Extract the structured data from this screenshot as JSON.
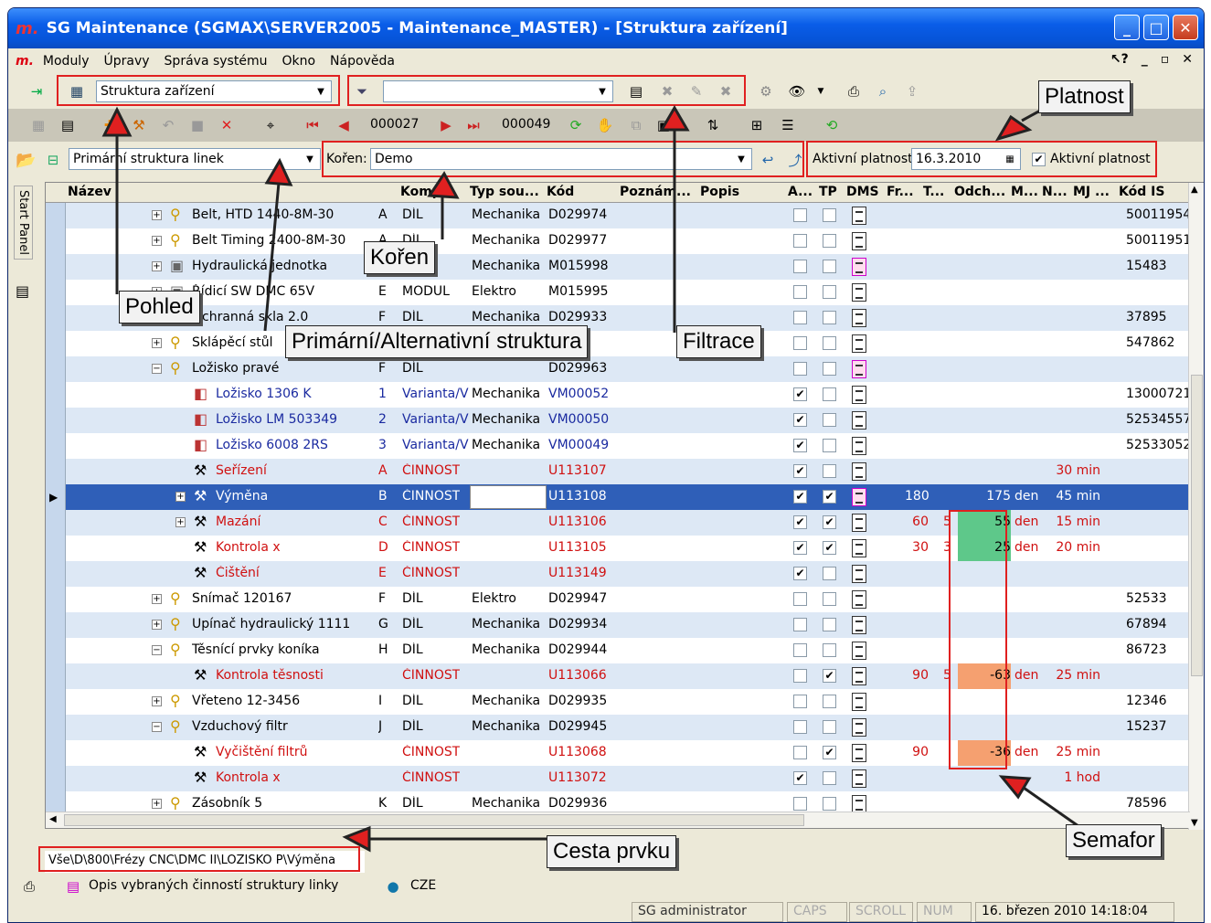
{
  "window": {
    "logo": "m.",
    "title": "SG Maintenance (SGMAX\\SERVER2005 - Maintenance_MASTER) - [Struktura zařízení]"
  },
  "menu": {
    "logo": "m.",
    "items": [
      "Moduly",
      "Úpravy",
      "Správa systému",
      "Okno",
      "Nápověda"
    ],
    "help": "?"
  },
  "toolbar1": {
    "view_combo": "Struktura zařízení",
    "filter_combo": ""
  },
  "toolbar2": {
    "first_record": "000027",
    "last_record": "000049"
  },
  "toolbar3": {
    "structure_combo": "Primární struktura linek",
    "root_label": "Kořen:",
    "root_value": "Demo",
    "validity_label": "Aktivní platnost:",
    "validity_date": "16.3.2010",
    "validity_check": "Aktivní platnost"
  },
  "side": {
    "start_panel": "Start Panel"
  },
  "columns": [
    "Název",
    "",
    "Komp",
    "Typ sou...",
    "Kód",
    "Poznám...",
    "Popis",
    "A...",
    "TP",
    "DMS",
    "Fr...",
    "T...",
    "Odch...",
    "M...",
    "N...",
    "MJ ...",
    "Kód IS"
  ],
  "rows": [
    {
      "name": "Belt, HTD 1440-8M-30",
      "pos": "A",
      "komp": "DÍL",
      "typ": "Mechanika",
      "kod": "D029974",
      "a": false,
      "tp": false,
      "dms": "doc",
      "fr": "",
      "t": "",
      "odch": "",
      "mj": "",
      "n": "",
      "kodis": "50011954",
      "color": "#000",
      "indent": 0,
      "exp": "+",
      "icon": "part"
    },
    {
      "name": "Belt Timing 2400-8M-30",
      "pos": "A",
      "komp": "DÍL",
      "typ": "Mechanika",
      "kod": "D029977",
      "a": false,
      "tp": false,
      "dms": "doc",
      "fr": "",
      "t": "",
      "odch": "",
      "mj": "",
      "n": "",
      "kodis": "50011951",
      "color": "#000",
      "indent": 0,
      "exp": "+",
      "icon": "part"
    },
    {
      "name": "Hydraulická jednotka",
      "pos": "A",
      "komp": "DÍL",
      "typ": "Mechanika",
      "kod": "M015998",
      "a": false,
      "tp": false,
      "dms": "pink",
      "fr": "",
      "t": "",
      "odch": "",
      "mj": "",
      "n": "",
      "kodis": "15483",
      "color": "#000",
      "indent": 0,
      "exp": "+",
      "icon": "box"
    },
    {
      "name": "Řídicí SW DMC 65V",
      "pos": "E",
      "komp": "MODUL",
      "typ": "Elektro",
      "kod": "M015995",
      "a": false,
      "tp": false,
      "dms": "doc",
      "fr": "",
      "t": "",
      "odch": "",
      "mj": "",
      "n": "",
      "kodis": "",
      "color": "#000",
      "indent": 0,
      "exp": "+",
      "icon": "box"
    },
    {
      "name": "Ochranná skla 2.0",
      "pos": "F",
      "komp": "DÍL",
      "typ": "Mechanika",
      "kod": "D029933",
      "a": false,
      "tp": false,
      "dms": "doc",
      "fr": "",
      "t": "",
      "odch": "",
      "mj": "",
      "n": "",
      "kodis": "37895",
      "color": "#000",
      "indent": 0,
      "exp": "+",
      "icon": "part"
    },
    {
      "name": "Sklápěcí stůl",
      "pos": "",
      "komp": "",
      "typ": "",
      "kod": "",
      "a": false,
      "tp": false,
      "dms": "doc",
      "fr": "",
      "t": "",
      "odch": "",
      "mj": "",
      "n": "",
      "kodis": "547862",
      "color": "#000",
      "indent": 0,
      "exp": "+",
      "icon": "part"
    },
    {
      "name": "Ložisko pravé",
      "pos": "F",
      "komp": "DÍL",
      "typ": "",
      "kod": "D029963",
      "a": false,
      "tp": false,
      "dms": "pink",
      "fr": "",
      "t": "",
      "odch": "",
      "mj": "",
      "n": "",
      "kodis": "",
      "color": "#000",
      "indent": 0,
      "exp": "−",
      "icon": "part"
    },
    {
      "name": "Ložisko 1306 K",
      "pos": "1",
      "komp": "Varianta/V",
      "typ": "Mechanika",
      "kod": "VM00052",
      "a": true,
      "tp": false,
      "dms": "doc",
      "fr": "",
      "t": "",
      "odch": "",
      "mj": "",
      "n": "",
      "kodis": "13000721",
      "color": "#1a2aa0",
      "indent": 1,
      "exp": "",
      "icon": "var"
    },
    {
      "name": "Ložisko   LM 503349",
      "pos": "2",
      "komp": "Varianta/V",
      "typ": "Mechanika",
      "kod": "VM00050",
      "a": true,
      "tp": false,
      "dms": "doc",
      "fr": "",
      "t": "",
      "odch": "",
      "mj": "",
      "n": "",
      "kodis": "52534557",
      "color": "#1a2aa0",
      "indent": 1,
      "exp": "",
      "icon": "var"
    },
    {
      "name": "Ložisko 6008 2RS",
      "pos": "3",
      "komp": "Varianta/V",
      "typ": "Mechanika",
      "kod": "VM00049",
      "a": true,
      "tp": false,
      "dms": "doc",
      "fr": "",
      "t": "",
      "odch": "",
      "mj": "",
      "n": "",
      "kodis": "52533052",
      "color": "#1a2aa0",
      "indent": 1,
      "exp": "",
      "icon": "var"
    },
    {
      "name": "Seřízení",
      "pos": "A",
      "komp": "ČINNOST",
      "typ": "",
      "kod": "U113107",
      "a": true,
      "tp": false,
      "dms": "doc",
      "fr": "",
      "t": "",
      "odch": "",
      "mj": "30 min",
      "n": "",
      "kodis": "",
      "color": "#d01010",
      "indent": 1,
      "exp": "",
      "icon": "act"
    },
    {
      "name": "Výměna",
      "pos": "B",
      "komp": "ČINNOST",
      "typ": "",
      "kod": "U113108",
      "a": true,
      "tp": true,
      "dms": "pink",
      "fr": "180",
      "t": "",
      "odch": "175",
      "n": "den",
      "mj": "45 min",
      "kodis": "",
      "color": "#fff",
      "indent": 1,
      "exp": "+",
      "icon": "act",
      "selected": true
    },
    {
      "name": "Mazání",
      "pos": "C",
      "komp": "ČINNOST",
      "typ": "",
      "kod": "U113106",
      "a": true,
      "tp": true,
      "dms": "doc",
      "fr": "60",
      "t": "5",
      "odch": "55",
      "n": "den",
      "mj": "15 min",
      "kodis": "",
      "color": "#d01010",
      "indent": 1,
      "exp": "+",
      "icon": "act",
      "sema": "#5ec88a"
    },
    {
      "name": "Kontrola x",
      "pos": "D",
      "komp": "ČINNOST",
      "typ": "",
      "kod": "U113105",
      "a": true,
      "tp": true,
      "dms": "doc",
      "fr": "30",
      "t": "3",
      "odch": "25",
      "n": "den",
      "mj": "20 min",
      "kodis": "",
      "color": "#d01010",
      "indent": 1,
      "exp": "",
      "icon": "act",
      "sema": "#5ec88a"
    },
    {
      "name": "Čištění",
      "pos": "E",
      "komp": "ČINNOST",
      "typ": "",
      "kod": "U113149",
      "a": true,
      "tp": false,
      "dms": "doc",
      "fr": "",
      "t": "",
      "odch": "",
      "n": "",
      "mj": "",
      "kodis": "",
      "color": "#d01010",
      "indent": 1,
      "exp": "",
      "icon": "act"
    },
    {
      "name": "Snímač  120167",
      "pos": "F",
      "komp": "DÍL",
      "typ": "Elektro",
      "kod": "D029947",
      "a": false,
      "tp": false,
      "dms": "doc",
      "fr": "",
      "t": "",
      "odch": "",
      "n": "",
      "mj": "",
      "kodis": "52533",
      "color": "#000",
      "indent": 0,
      "exp": "+",
      "icon": "part"
    },
    {
      "name": "Upínač hydraulický 1111",
      "pos": "G",
      "komp": "DÍL",
      "typ": "Mechanika",
      "kod": "D029934",
      "a": false,
      "tp": false,
      "dms": "doc",
      "fr": "",
      "t": "",
      "odch": "",
      "n": "",
      "mj": "",
      "kodis": "67894",
      "color": "#000",
      "indent": 0,
      "exp": "+",
      "icon": "part"
    },
    {
      "name": "Těsnící prvky koníka",
      "pos": "H",
      "komp": "DÍL",
      "typ": "Mechanika",
      "kod": "D029944",
      "a": false,
      "tp": false,
      "dms": "doc",
      "fr": "",
      "t": "",
      "odch": "",
      "n": "",
      "mj": "",
      "kodis": "86723",
      "color": "#000",
      "indent": 0,
      "exp": "−",
      "icon": "part"
    },
    {
      "name": "Kontrola těsnosti",
      "pos": "",
      "komp": "ČINNOST",
      "typ": "",
      "kod": "U113066",
      "a": false,
      "tp": true,
      "dms": "doc",
      "fr": "90",
      "t": "5",
      "odch": "-63",
      "n": "den",
      "mj": "25 min",
      "kodis": "",
      "color": "#d01010",
      "indent": 1,
      "exp": "",
      "icon": "act",
      "sema": "#f5a070"
    },
    {
      "name": "Vřeteno 12-3456",
      "pos": "I",
      "komp": "DÍL",
      "typ": "Mechanika",
      "kod": "D029935",
      "a": false,
      "tp": false,
      "dms": "doc",
      "fr": "",
      "t": "",
      "odch": "",
      "n": "",
      "mj": "",
      "kodis": "12346",
      "color": "#000",
      "indent": 0,
      "exp": "+",
      "icon": "part"
    },
    {
      "name": "Vzduchový filtr",
      "pos": "J",
      "komp": "DÍL",
      "typ": "Mechanika",
      "kod": "D029945",
      "a": false,
      "tp": false,
      "dms": "doc",
      "fr": "",
      "t": "",
      "odch": "",
      "n": "",
      "mj": "",
      "kodis": "15237",
      "color": "#000",
      "indent": 0,
      "exp": "−",
      "icon": "part"
    },
    {
      "name": "Vyčištění filtrů",
      "pos": "",
      "komp": "ČINNOST",
      "typ": "",
      "kod": "U113068",
      "a": false,
      "tp": true,
      "dms": "doc",
      "fr": "90",
      "t": "",
      "odch": "-36",
      "n": "den",
      "mj": "25 min",
      "kodis": "",
      "color": "#d01010",
      "indent": 1,
      "exp": "",
      "icon": "act",
      "sema": "#f5a070"
    },
    {
      "name": "Kontrola x",
      "pos": "",
      "komp": "ČINNOST",
      "typ": "",
      "kod": "U113072",
      "a": true,
      "tp": false,
      "dms": "doc",
      "fr": "",
      "t": "",
      "odch": "",
      "n": "",
      "mj": "1 hod",
      "kodis": "",
      "color": "#d01010",
      "indent": 1,
      "exp": "",
      "icon": "act"
    },
    {
      "name": "Zásobník 5",
      "pos": "K",
      "komp": "DÍL",
      "typ": "Mechanika",
      "kod": "D029936",
      "a": false,
      "tp": false,
      "dms": "doc",
      "fr": "",
      "t": "",
      "odch": "",
      "n": "",
      "mj": "",
      "kodis": "78596",
      "color": "#000",
      "indent": 0,
      "exp": "+",
      "icon": "part"
    }
  ],
  "path": "Vše\\D\\800\\Frézy CNC\\DMC II\\LOZISKO P\\Výměna",
  "status1": {
    "opis": "Opis vybraných činností struktury linky",
    "lang": "CZE"
  },
  "status2": {
    "user": "SG administrator",
    "caps": "CAPS",
    "scroll": "SCROLL",
    "num": "NUM",
    "datetime": "16. březen 2010 14:18:04"
  },
  "callouts": {
    "platnost": "Platnost",
    "koren": "Kořen",
    "pohled": "Pohled",
    "struktura": "Primární/Alternativní struktura",
    "filtrace": "Filtrace",
    "cesta": "Cesta prvku",
    "semafor": "Semafor"
  },
  "colors": {
    "title": "#0a5de8",
    "selected": "#2f5fb8",
    "row_alt": "#dde8f5",
    "callout_box": "#e02020",
    "sema_green": "#5ec88a",
    "sema_red": "#f5a070"
  }
}
